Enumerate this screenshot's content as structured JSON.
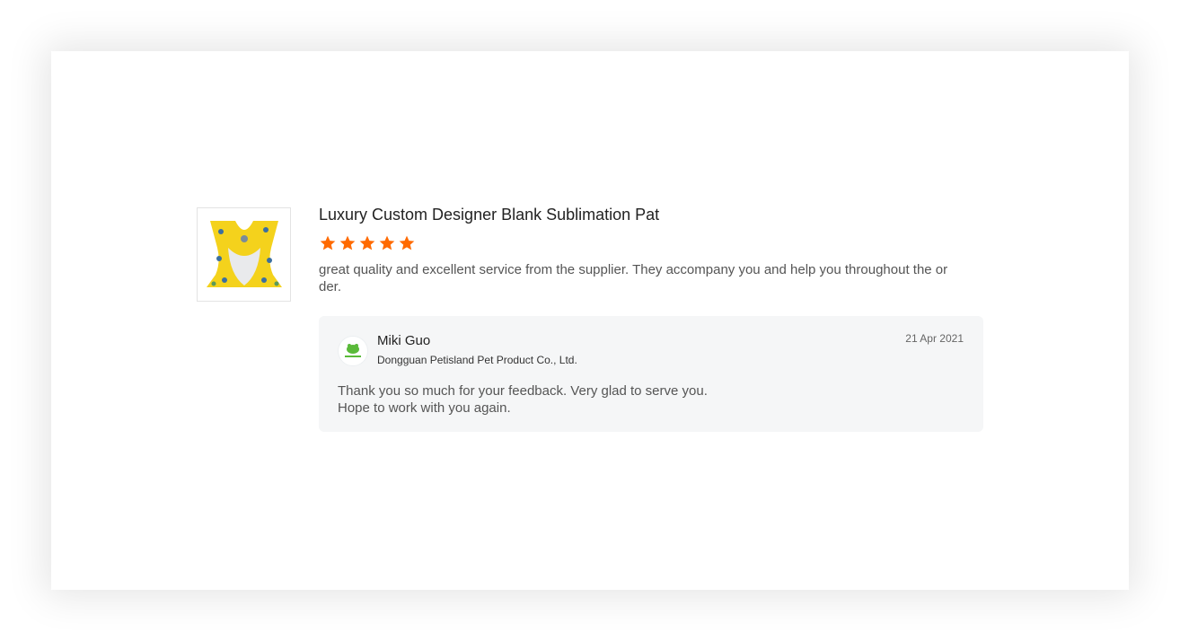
{
  "product": {
    "title": "Luxury Custom Designer Blank Sublimation Pat…",
    "thumbnail_icon": "pet-harness-image",
    "rating": 5,
    "rating_max": 5
  },
  "review": {
    "text": "great quality and excellent service from the supplier.  They accompany you and help you throughout the order."
  },
  "reply": {
    "name": "Miki Guo",
    "company": "Dongguan Petisland Pet Product Co., Ltd.",
    "date": "21 Apr 2021",
    "text": "Thank you so much for your feedback. Very glad to serve you.\nHope to work with you again.",
    "avatar_icon": "petisland-logo"
  },
  "colors": {
    "star": "#ff6a00",
    "reply_bg": "#f5f6f7"
  }
}
